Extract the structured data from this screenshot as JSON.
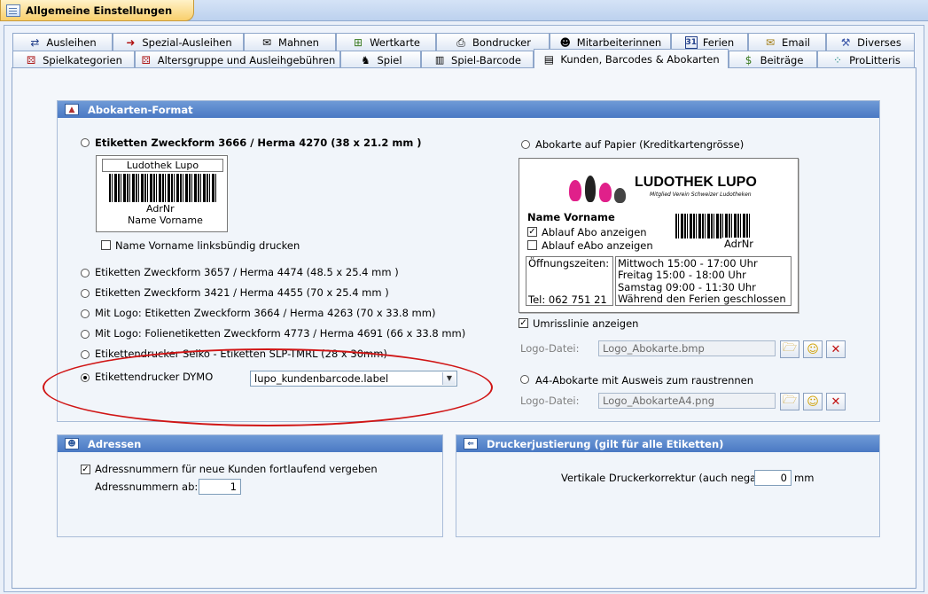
{
  "window": {
    "title": "Allgemeine Einstellungen"
  },
  "tabs_row1": [
    {
      "label": "Ausleihen",
      "icon": "arrows-icon"
    },
    {
      "label": "Spezial-Ausleihen",
      "icon": "red-arrow-icon"
    },
    {
      "label": "Mahnen",
      "icon": "envelope-search-icon"
    },
    {
      "label": "Wertkarte",
      "icon": "card-add-icon"
    },
    {
      "label": "Bondrucker",
      "icon": "printer-icon"
    },
    {
      "label": "Mitarbeiterinnen",
      "icon": "person-icon"
    },
    {
      "label": "Ferien",
      "icon": "calendar-icon",
      "calendar_day": "31"
    },
    {
      "label": "Email",
      "icon": "email-icon"
    },
    {
      "label": "Diverses",
      "icon": "tools-icon"
    }
  ],
  "tabs_row2": [
    {
      "label": "Spielkategorien",
      "icon": "dice-icon"
    },
    {
      "label": "Altersgruppe und Ausleihgebühren",
      "icon": "dice-icon"
    },
    {
      "label": "Spiel",
      "icon": "toy-icon"
    },
    {
      "label": "Spiel-Barcode",
      "icon": "barcode-icon"
    },
    {
      "label": "Kunden, Barcodes & Abokarten",
      "icon": "id-card-icon",
      "active": true
    },
    {
      "label": "Beiträge",
      "icon": "money-icon"
    },
    {
      "label": "ProLitteris",
      "icon": "dots-icon"
    }
  ],
  "abokarten": {
    "header": "Abokarten-Format",
    "option_zweckform3666": "Etiketten Zweckform 3666 / Herma 4270 (38 x 21.2 mm )",
    "label_preview": {
      "name": "Ludothek Lupo",
      "adrnr": "AdrNr",
      "vorname": "Name Vorname"
    },
    "linksbuendig": "Name Vorname linksbündig drucken",
    "options": [
      "Etiketten Zweckform 3657 / Herma 4474 (48.5 x 25.4 mm )",
      "Etiketten Zweckform 3421 / Herma 4455 (70 x 25.4 mm )",
      "Mit Logo: Etiketten Zweckform 3664 / Herma 4263 (70 x 33.8 mm)",
      "Mit Logo: Folienetiketten Zweckform 4773 / Herma 4691 (66 x 33.8 mm)",
      "Etikettendrucker Seiko - Etiketten SLP-TMRL (28 x 30mm)"
    ],
    "dymo_label": "Etikettendrucker DYMO",
    "dymo_value": "lupo_kundenbarcode.label",
    "papier_label": "Abokarte auf Papier (Kreditkartengrösse)",
    "card": {
      "brand": "LUDOTHEK LUPO",
      "tagline": "Mitglied Verein Schweizer Ludotheken",
      "name": "Name Vorname",
      "ablauf_abo": "Ablauf Abo anzeigen",
      "ablauf_eabo": "Ablauf eAbo anzeigen",
      "adrnr": "AdrNr",
      "oeffnung": "Öffnungszeiten:",
      "tel": "Tel: 062 751 21",
      "hours": [
        "Mittwoch 15:00 - 17:00 Uhr",
        "Freitag 15:00 - 18:00 Uhr",
        "Samstag 09:00 - 11:30 Uhr",
        "Während den Ferien geschlossen"
      ]
    },
    "umriss": "Umrisslinie anzeigen",
    "logo_label": "Logo-Datei:",
    "logo_value": "Logo_Abokarte.bmp",
    "a4_label": "A4-Abokarte mit Ausweis zum raustrennen",
    "logo2_label": "Logo-Datei:",
    "logo2_value": "Logo_AbokarteA4.png"
  },
  "adressen": {
    "header": "Adressen",
    "fortlaufend": "Adressnummern für neue Kunden fortlaufend vergeben",
    "ab_label": "Adressnummern ab:",
    "ab_value": "1"
  },
  "drucker": {
    "header": "Druckerjustierung (gilt für alle Etiketten)",
    "label": "Vertikale Druckerkorrektur (auch negative):",
    "value": "0",
    "unit": "mm"
  },
  "colors": {
    "header": "#4a79c4",
    "accent_tab": "#f9cf6c",
    "highlight": "#d01515",
    "brand_pink": "#e0208a"
  }
}
